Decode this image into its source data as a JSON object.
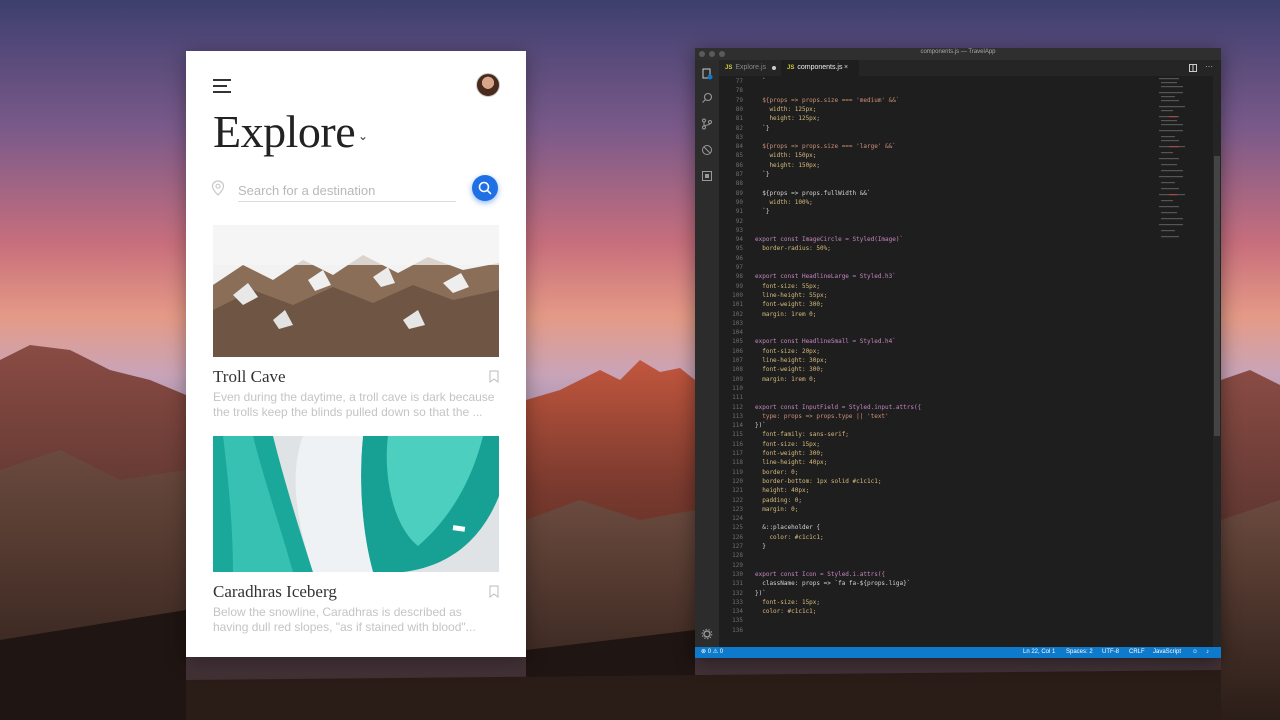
{
  "colors": {
    "accent": "#1f6fe5",
    "editor_bg": "#1e1e1e",
    "status_bar": "#0e7acc"
  },
  "app": {
    "title": "Explore",
    "search_placeholder": "Search for a destination",
    "icons": {
      "menu": "hamburger-menu-icon",
      "search": "search-icon",
      "location": "location-pin-icon",
      "bookmark": "bookmark-icon",
      "dropdown": "chevron-down-icon"
    },
    "cards": [
      {
        "title": "Troll Cave",
        "description": [
          "Even during the daytime, a troll cave is dark because",
          "the trolls keep the blinds pulled down so that the ..."
        ]
      },
      {
        "title": "Caradhras Iceberg",
        "description": [
          "Below the snowline, Caradhras is described as",
          "having dull red slopes, \"as if stained with blood\"..."
        ]
      }
    ]
  },
  "editor": {
    "window_title": "components.js — TravelApp",
    "tabs": [
      {
        "tag": "JS",
        "label": "Explore.js",
        "modified": true
      },
      {
        "tag": "JS",
        "label": "components.js",
        "close": "×"
      }
    ],
    "code_lines": [
      {
        "n": "77",
        "t": "  `"
      },
      {
        "n": "78",
        "t": ""
      },
      {
        "n": "79",
        "t": "  ${props => props.size === 'medium' &&`"
      },
      {
        "n": "80",
        "t": "    width: 125px;"
      },
      {
        "n": "81",
        "t": "    height: 125px;"
      },
      {
        "n": "82",
        "t": "  `}"
      },
      {
        "n": "83",
        "t": ""
      },
      {
        "n": "84",
        "t": "  ${props => props.size === 'large' &&`"
      },
      {
        "n": "85",
        "t": "    width: 150px;"
      },
      {
        "n": "86",
        "t": "    height: 150px;"
      },
      {
        "n": "87",
        "t": "  `}"
      },
      {
        "n": "88",
        "t": ""
      },
      {
        "n": "89",
        "t": "  ${props => props.fullWidth &&`"
      },
      {
        "n": "90",
        "t": "    width: 100%;"
      },
      {
        "n": "91",
        "t": "  `}"
      },
      {
        "n": "92",
        "t": ""
      },
      {
        "n": "93",
        "t": ""
      },
      {
        "n": "94",
        "t": "export const ImageCircle = Styled(Image)`"
      },
      {
        "n": "95",
        "t": "  border-radius: 50%;"
      },
      {
        "n": "96",
        "t": ""
      },
      {
        "n": "97",
        "t": ""
      },
      {
        "n": "98",
        "t": "export const HeadlineLarge = Styled.h3`"
      },
      {
        "n": "99",
        "t": "  font-size: 55px;"
      },
      {
        "n": "100",
        "t": "  line-height: 55px;"
      },
      {
        "n": "101",
        "t": "  font-weight: 300;"
      },
      {
        "n": "102",
        "t": "  margin: 1rem 0;"
      },
      {
        "n": "103",
        "t": ""
      },
      {
        "n": "104",
        "t": ""
      },
      {
        "n": "105",
        "t": "export const HeadlineSmall = Styled.h4`"
      },
      {
        "n": "106",
        "t": "  font-size: 20px;"
      },
      {
        "n": "107",
        "t": "  line-height: 30px;"
      },
      {
        "n": "108",
        "t": "  font-weight: 300;"
      },
      {
        "n": "109",
        "t": "  margin: 1rem 0;"
      },
      {
        "n": "110",
        "t": ""
      },
      {
        "n": "111",
        "t": ""
      },
      {
        "n": "112",
        "t": "export const InputField = Styled.input.attrs({"
      },
      {
        "n": "113",
        "t": "  type: props => props.type || 'text'"
      },
      {
        "n": "114",
        "t": "})`"
      },
      {
        "n": "115",
        "t": "  font-family: sans-serif;"
      },
      {
        "n": "116",
        "t": "  font-size: 15px;"
      },
      {
        "n": "117",
        "t": "  font-weight: 300;"
      },
      {
        "n": "118",
        "t": "  line-height: 40px;"
      },
      {
        "n": "119",
        "t": "  border: 0;"
      },
      {
        "n": "120",
        "t": "  border-bottom: 1px solid #c1c1c1;"
      },
      {
        "n": "121",
        "t": "  height: 40px;"
      },
      {
        "n": "122",
        "t": "  padding: 0;"
      },
      {
        "n": "123",
        "t": "  margin: 0;"
      },
      {
        "n": "124",
        "t": ""
      },
      {
        "n": "125",
        "t": "  &::placeholder {"
      },
      {
        "n": "126",
        "t": "    color: #c1c1c1;"
      },
      {
        "n": "127",
        "t": "  }"
      },
      {
        "n": "128",
        "t": ""
      },
      {
        "n": "129",
        "t": ""
      },
      {
        "n": "130",
        "t": "export const Icon = Styled.i.attrs({"
      },
      {
        "n": "131",
        "t": "  className: props => `fa fa-${props.liga}`"
      },
      {
        "n": "132",
        "t": "})`"
      },
      {
        "n": "133",
        "t": "  font-size: 15px;"
      },
      {
        "n": "134",
        "t": "  color: #c1c1c1;"
      },
      {
        "n": "135",
        "t": ""
      },
      {
        "n": "136",
        "t": ""
      }
    ],
    "status": {
      "errors": "0",
      "warnings": "0",
      "position": "Ln 22, Col 1",
      "spaces": "Spaces: 2",
      "encoding": "UTF-8",
      "eol": "CRLF",
      "language": "JavaScript"
    }
  }
}
